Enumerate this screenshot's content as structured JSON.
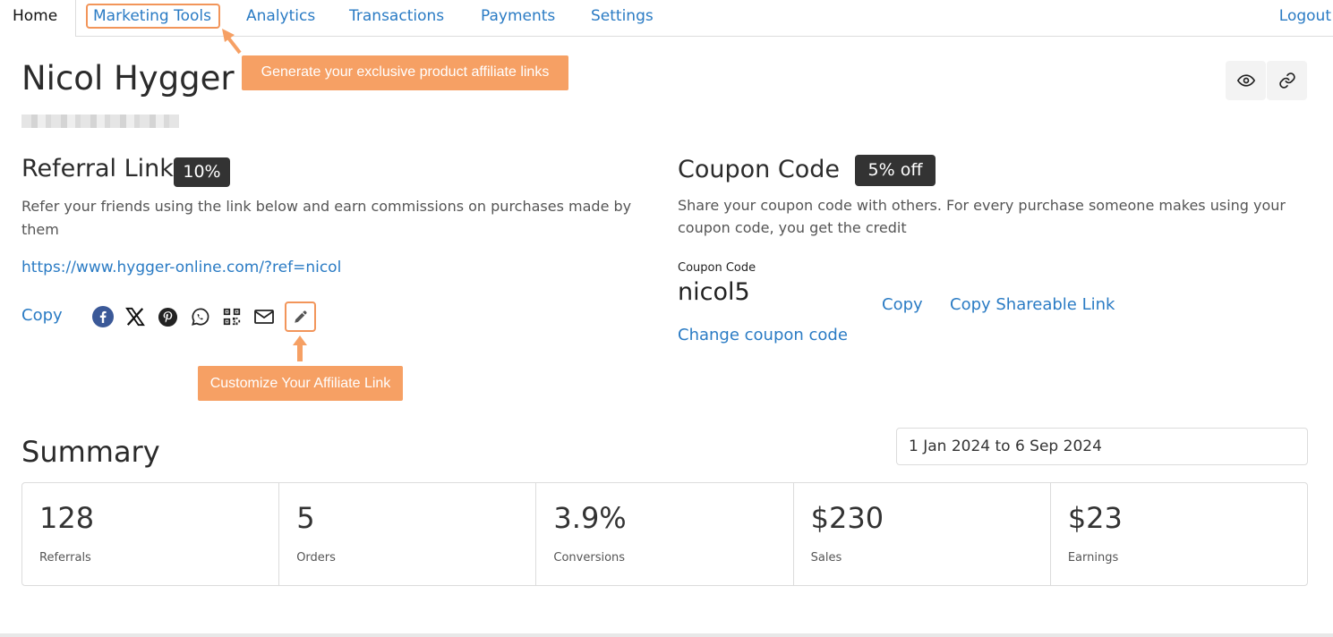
{
  "nav": {
    "home": "Home",
    "marketing_tools": "Marketing Tools",
    "analytics": "Analytics",
    "transactions": "Transactions",
    "payments": "Payments",
    "settings": "Settings",
    "logout": "Logout"
  },
  "annotations": {
    "marketing_tip": "Generate your exclusive product affiliate links",
    "customize_tip": "Customize Your Affiliate Link",
    "color": "#f6a064"
  },
  "header": {
    "name": "Nicol Hygger",
    "icons": [
      "eye-icon",
      "link-icon"
    ]
  },
  "referral": {
    "title": "Referral Link",
    "badge": "10%",
    "description": "Refer your friends using the link below and earn commissions on purchases made by them",
    "url": "https://www.hygger-online.com/?ref=nicol",
    "copy_label": "Copy",
    "share_icons": [
      "facebook-icon",
      "x-icon",
      "pinterest-icon",
      "whatsapp-icon",
      "qr-code-icon",
      "email-icon",
      "edit-icon"
    ]
  },
  "coupon": {
    "title": "Coupon Code",
    "badge": "5% off",
    "description": "Share your coupon code with others. For every purchase someone makes using your coupon code, you get the credit",
    "label": "Coupon Code",
    "code": "nicol5",
    "copy_label": "Copy",
    "copy_shareable_label": "Copy Shareable Link",
    "change_label": "Change coupon code"
  },
  "summary": {
    "title": "Summary",
    "date_range": "1 Jan 2024 to 6 Sep 2024",
    "stats": [
      {
        "value": "128",
        "label": "Referrals"
      },
      {
        "value": "5",
        "label": "Orders"
      },
      {
        "value": "3.9%",
        "label": "Conversions"
      },
      {
        "value": "$230",
        "label": "Sales"
      },
      {
        "value": "$23",
        "label": "Earnings"
      }
    ]
  },
  "colors": {
    "link": "#2a7bc4",
    "badge_bg": "#333333",
    "highlight_border": "#f2955a"
  }
}
